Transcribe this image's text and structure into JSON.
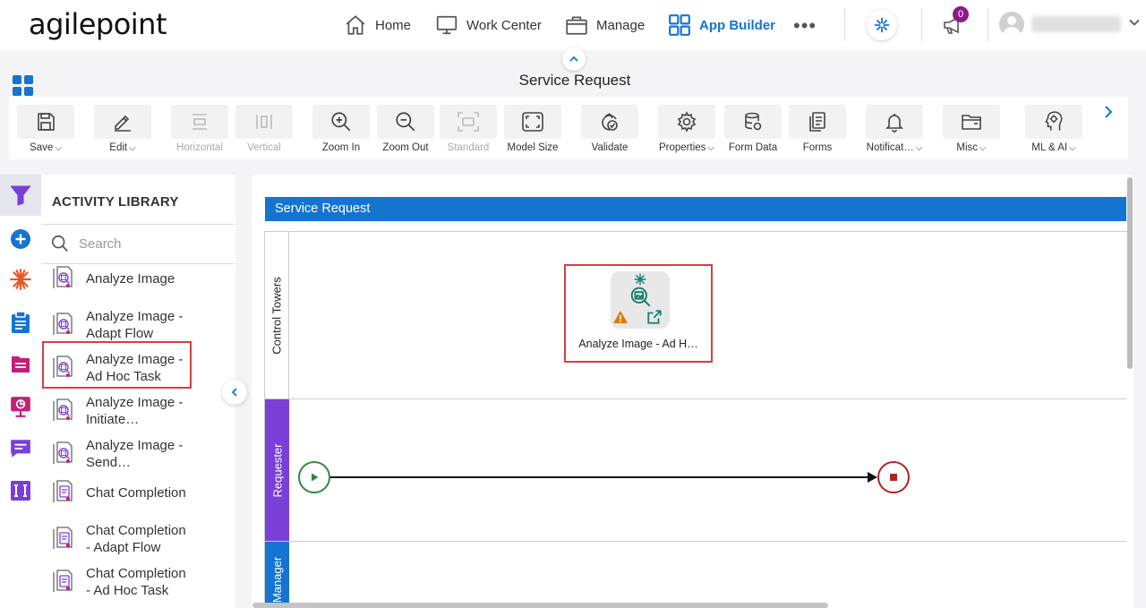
{
  "brand": {
    "logo_text": "agilepoint"
  },
  "nav": {
    "items": [
      {
        "label": "Home",
        "icon": "home-icon"
      },
      {
        "label": "Work Center",
        "icon": "monitor-icon"
      },
      {
        "label": "Manage",
        "icon": "briefcase-icon"
      },
      {
        "label": "App Builder",
        "icon": "grid-icon",
        "active": true
      }
    ],
    "more_label": "•••",
    "notification_count": "0"
  },
  "page": {
    "title": "Service Request"
  },
  "toolbar": {
    "items": [
      {
        "label": "Save",
        "icon": "save-icon",
        "has_menu": true,
        "enabled": true
      },
      {
        "label": "Edit",
        "icon": "pencil-icon",
        "has_menu": true,
        "enabled": true
      },
      {
        "label": "Horizontal",
        "icon": "horizontal-layout-icon",
        "has_menu": false,
        "enabled": false
      },
      {
        "label": "Vertical",
        "icon": "vertical-layout-icon",
        "has_menu": false,
        "enabled": false
      },
      {
        "label": "Zoom In",
        "icon": "zoom-in-icon",
        "has_menu": false,
        "enabled": true
      },
      {
        "label": "Zoom Out",
        "icon": "zoom-out-icon",
        "has_menu": false,
        "enabled": true
      },
      {
        "label": "Standard",
        "icon": "standard-size-icon",
        "has_menu": false,
        "enabled": false
      },
      {
        "label": "Model Size",
        "icon": "fit-screen-icon",
        "has_menu": false,
        "enabled": true
      },
      {
        "label": "Validate",
        "icon": "validate-icon",
        "has_menu": false,
        "enabled": true
      },
      {
        "label": "Properties",
        "icon": "gear-icon",
        "has_menu": true,
        "enabled": true
      },
      {
        "label": "Form Data",
        "icon": "database-icon",
        "has_menu": false,
        "enabled": true
      },
      {
        "label": "Forms",
        "icon": "forms-icon",
        "has_menu": false,
        "enabled": true
      },
      {
        "label": "Notificat…",
        "icon": "bell-icon",
        "has_menu": true,
        "enabled": true
      },
      {
        "label": "Misc",
        "icon": "folder-icon",
        "has_menu": true,
        "enabled": true
      },
      {
        "label": "ML & AI",
        "icon": "ai-brain-icon",
        "has_menu": true,
        "enabled": true
      }
    ]
  },
  "library": {
    "title": "ACTIVITY LIBRARY",
    "search_placeholder": "Search",
    "items": [
      {
        "label": "Analyze Image",
        "icon": "analyze-image-icon"
      },
      {
        "label": "Analyze Image - Adapt Flow",
        "icon": "analyze-image-adapt-icon"
      },
      {
        "label": "Analyze Image - Ad Hoc Task",
        "icon": "analyze-image-adhoc-icon",
        "highlighted": true
      },
      {
        "label": "Analyze Image - Initiate…",
        "icon": "analyze-image-initiate-icon"
      },
      {
        "label": "Analyze Image - Send…",
        "icon": "analyze-image-send-icon"
      },
      {
        "label": "Chat Completion",
        "icon": "chat-completion-icon"
      },
      {
        "label": "Chat Completion - Adapt Flow",
        "icon": "chat-completion-adapt-icon"
      },
      {
        "label": "Chat Completion - Ad Hoc Task",
        "icon": "chat-completion-adhoc-icon"
      }
    ]
  },
  "canvas": {
    "pool_name": "Service Request",
    "lanes": [
      {
        "name": "Control Towers"
      },
      {
        "name": "Requester"
      },
      {
        "name": "Manager"
      }
    ],
    "shape_label": "Analyze Image - Ad H…"
  },
  "colors": {
    "accent": "#1474cf",
    "requester_lane": "#7a3fd6",
    "highlight": "#d44040",
    "start_event": "#2e8b3e",
    "end_event": "#b22222"
  }
}
